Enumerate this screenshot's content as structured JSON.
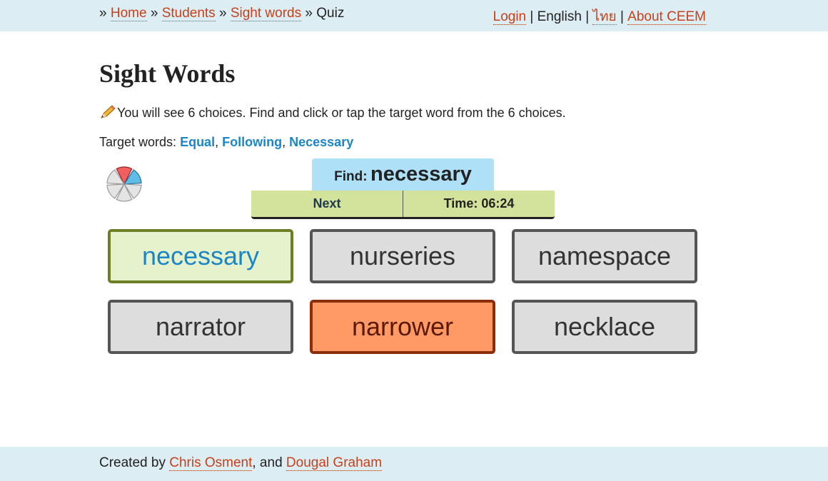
{
  "breadcrumb": {
    "prefix": "»",
    "home": "Home",
    "students": "Students",
    "sight_words": "Sight words",
    "current": "Quiz",
    "sep": "»"
  },
  "nav": {
    "login": "Login",
    "english": "English",
    "thai": "ไทย",
    "about": "About CEEM",
    "divider": "|"
  },
  "page": {
    "title": "Sight Words",
    "instructions": "You will see 6 choices. Find and click or tap the target word from the 6 choices.",
    "targets_label": "Target words:",
    "targets": [
      "Equal",
      "Following",
      "Necessary"
    ],
    "comma": ","
  },
  "quiz": {
    "find_label": "Find:",
    "find_word": "necessary",
    "next_label": "Next",
    "time_text": "Time: 06:24",
    "progress": {
      "total_segments": 6,
      "correct_segments": 1,
      "wrong_segments": 1
    }
  },
  "choices": [
    {
      "word": "necessary",
      "state": "correct"
    },
    {
      "word": "nurseries",
      "state": "neutral"
    },
    {
      "word": "namespace",
      "state": "neutral"
    },
    {
      "word": "narrator",
      "state": "neutral"
    },
    {
      "word": "narrower",
      "state": "wrong"
    },
    {
      "word": "necklace",
      "state": "neutral"
    }
  ],
  "footer": {
    "created_by": "Created by",
    "author1": "Chris Osment",
    "and": ", and",
    "author2": "Dougal Graham"
  },
  "colors": {
    "bar_bg": "#dcedf3",
    "link": "#c8401a",
    "target_word": "#1b86c7",
    "find_bg": "#aee0f8",
    "controls_bg": "#d3e39b",
    "choice_bg": "#dddddd",
    "correct_bg": "#e5f2cc",
    "wrong_bg": "#ff9a66"
  }
}
